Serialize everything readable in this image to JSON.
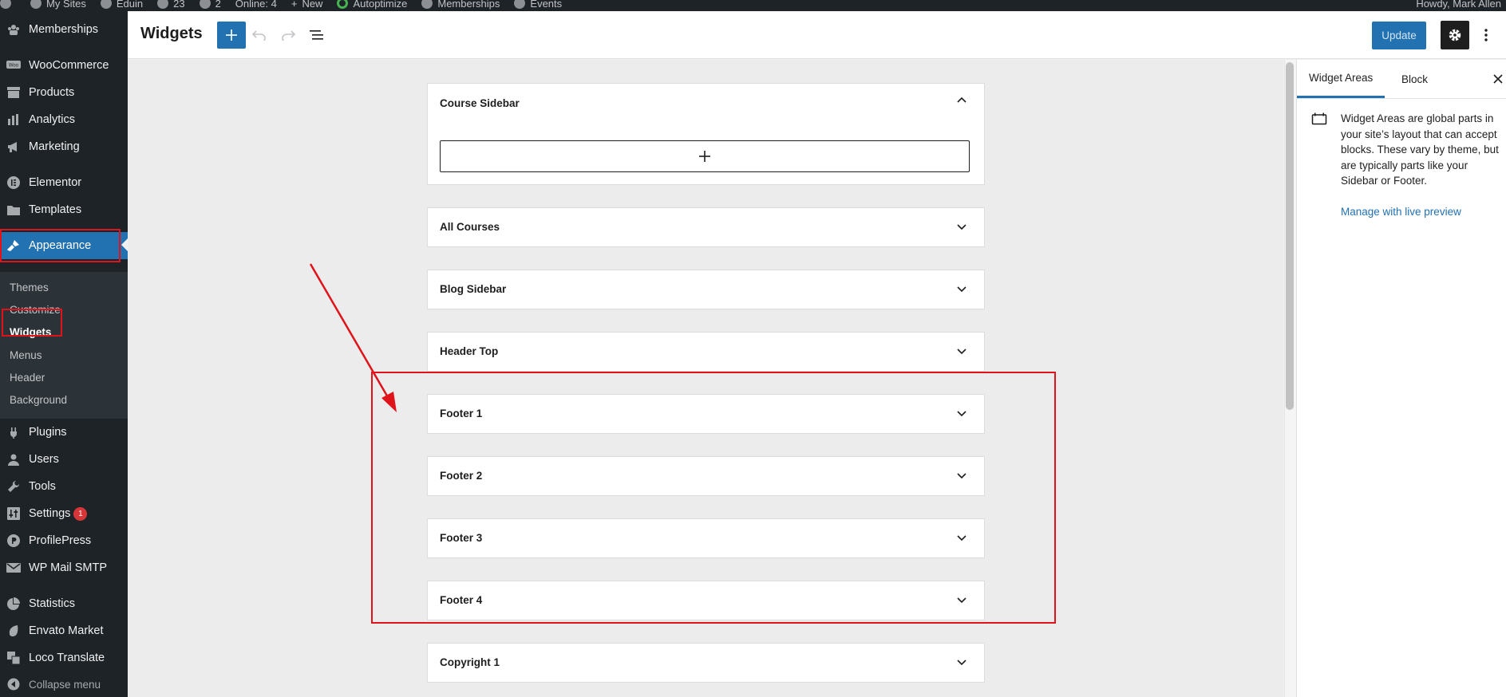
{
  "admin_bar": {
    "items": [
      "My Sites",
      "Eduin",
      "23",
      "2",
      "Online: 4",
      "New",
      "Autoptimize",
      "Memberships",
      "Events"
    ],
    "howdy": "Howdy, Mark Allen"
  },
  "menu": {
    "memberships": "Memberships",
    "woocommerce": "WooCommerce",
    "products": "Products",
    "analytics": "Analytics",
    "marketing": "Marketing",
    "elementor": "Elementor",
    "templates": "Templates",
    "appearance": "Appearance",
    "plugins": "Plugins",
    "users": "Users",
    "tools": "Tools",
    "settings": "Settings",
    "settings_badge": "1",
    "profilepress": "ProfilePress",
    "wp_mail_smtp": "WP Mail SMTP",
    "statistics": "Statistics",
    "envato_market": "Envato Market",
    "loco_translate": "Loco Translate",
    "collapse": "Collapse menu"
  },
  "submenu": {
    "themes": "Themes",
    "customize": "Customize",
    "widgets": "Widgets",
    "menus": "Menus",
    "header": "Header",
    "background": "Background"
  },
  "header": {
    "title": "Widgets",
    "update_label": "Update"
  },
  "widget_areas": [
    {
      "title": "Course Sidebar",
      "expanded": true
    },
    {
      "title": "All Courses",
      "expanded": false
    },
    {
      "title": "Blog Sidebar",
      "expanded": false
    },
    {
      "title": "Header Top",
      "expanded": false
    },
    {
      "title": "Footer 1",
      "expanded": false
    },
    {
      "title": "Footer 2",
      "expanded": false
    },
    {
      "title": "Footer 3",
      "expanded": false
    },
    {
      "title": "Footer 4",
      "expanded": false
    },
    {
      "title": "Copyright 1",
      "expanded": false
    }
  ],
  "sidebar": {
    "tab_widget_areas": "Widget Areas",
    "tab_block": "Block",
    "description": "Widget Areas are global parts in your site’s layout that can accept blocks. These vary by theme, but are typically parts like your Sidebar or Footer.",
    "manage_link": "Manage with live preview"
  },
  "colors": {
    "admin_dark": "#1d2327",
    "accent": "#2271b1",
    "annotation_red": "#e0131a"
  }
}
